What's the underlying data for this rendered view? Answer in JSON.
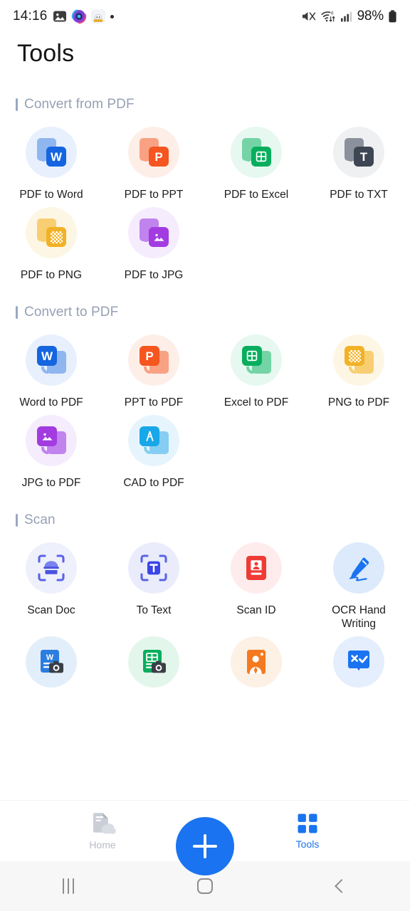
{
  "status_bar": {
    "time": "14:16",
    "battery_percent": "98%",
    "icons": [
      "gallery-icon",
      "circle-app-icon",
      "cat-app-icon",
      "dot-indicator",
      "mute-icon",
      "wifi-6-icon",
      "signal-bars-icon",
      "battery-icon"
    ]
  },
  "header": {
    "title": "Tools"
  },
  "sections": [
    {
      "title": "Convert from PDF",
      "items": [
        {
          "label": "PDF to Word",
          "icon": "pdf-to-word-icon",
          "glyph": "W",
          "badge_color": "#1565e0",
          "sheet_color": "#8fb6ef",
          "bg": "#e8f0fd",
          "layout": "from"
        },
        {
          "label": "PDF to PPT",
          "icon": "pdf-to-ppt-icon",
          "glyph": "P",
          "badge_color": "#f5551f",
          "sheet_color": "#f9a183",
          "bg": "#fdeee8",
          "layout": "from"
        },
        {
          "label": "PDF to Excel",
          "icon": "pdf-to-excel-icon",
          "glyph": "grid",
          "badge_color": "#08ae5e",
          "sheet_color": "#74d4a6",
          "bg": "#e6f8ef",
          "layout": "from"
        },
        {
          "label": "PDF to TXT",
          "icon": "pdf-to-txt-icon",
          "glyph": "T",
          "badge_color": "#3e4654",
          "sheet_color": "#8b919c",
          "bg": "#eef0f2",
          "layout": "from"
        },
        {
          "label": "PDF to PNG",
          "icon": "pdf-to-png-icon",
          "glyph": "checker",
          "badge_color": "#f2b227",
          "sheet_color": "#f7cf72",
          "bg": "#fdf6e4",
          "layout": "from"
        },
        {
          "label": "PDF to JPG",
          "icon": "pdf-to-jpg-icon",
          "glyph": "photo",
          "badge_color": "#a23ce0",
          "sheet_color": "#c183ee",
          "bg": "#f5ecfd",
          "layout": "from"
        }
      ]
    },
    {
      "title": "Convert to PDF",
      "items": [
        {
          "label": "Word to PDF",
          "icon": "word-to-pdf-icon",
          "glyph": "W",
          "badge_color": "#1565e0",
          "sheet_color": "#8fb6ef",
          "bg": "#e8f0fd",
          "layout": "to"
        },
        {
          "label": "PPT to PDF",
          "icon": "ppt-to-pdf-icon",
          "glyph": "P",
          "badge_color": "#f5551f",
          "sheet_color": "#f9a183",
          "bg": "#fdeee8",
          "layout": "to"
        },
        {
          "label": "Excel to PDF",
          "icon": "excel-to-pdf-icon",
          "glyph": "grid",
          "badge_color": "#08ae5e",
          "sheet_color": "#74d4a6",
          "bg": "#e6f8ef",
          "layout": "to"
        },
        {
          "label": "PNG to PDF",
          "icon": "png-to-pdf-icon",
          "glyph": "checker",
          "badge_color": "#f2b227",
          "sheet_color": "#f7cf72",
          "bg": "#fdf6e4",
          "layout": "to"
        },
        {
          "label": "JPG to PDF",
          "icon": "jpg-to-pdf-icon",
          "glyph": "photo",
          "badge_color": "#a23ce0",
          "sheet_color": "#c183ee",
          "bg": "#f5ecfd",
          "layout": "to"
        },
        {
          "label": "CAD to PDF",
          "icon": "cad-to-pdf-icon",
          "glyph": "compass",
          "badge_color": "#18a7e8",
          "sheet_color": "#85cdf2",
          "bg": "#e6f5fd",
          "layout": "to"
        }
      ]
    },
    {
      "title": "Scan",
      "items": [
        {
          "label": "Scan Doc",
          "icon": "scan-doc-icon",
          "glyph": "scan-frame",
          "badge_color": "#5a63e8",
          "bg": "#eef0fb"
        },
        {
          "label": "To Text",
          "icon": "to-text-icon",
          "glyph": "scan-text",
          "badge_color": "#3b45e8",
          "bg": "#eaecfb"
        },
        {
          "label": "Scan ID",
          "icon": "scan-id-icon",
          "glyph": "id-card",
          "badge_color": "#ef3b36",
          "bg": "#fdeceb"
        },
        {
          "label": "OCR Hand Writing",
          "icon": "ocr-handwriting-icon",
          "glyph": "pen-write",
          "badge_color": "#1a73f0",
          "bg": "#dceafc"
        },
        {
          "label": "",
          "icon": "word-scan-icon",
          "glyph": "word-camera",
          "badge_color": "#2b7de0",
          "bg": "#e3eefb"
        },
        {
          "label": "",
          "icon": "excel-scan-icon",
          "glyph": "excel-camera",
          "badge_color": "#08ae5e",
          "bg": "#e3f6ec"
        },
        {
          "label": "",
          "icon": "portrait-scan-icon",
          "glyph": "portrait",
          "badge_color": "#f57a1f",
          "bg": "#fdf0e4"
        },
        {
          "label": "",
          "icon": "grading-icon",
          "glyph": "x-check",
          "badge_color": "#1a73f0",
          "bg": "#e4eefc"
        }
      ]
    }
  ],
  "tabs": [
    {
      "label": "Home",
      "icon": "home-doc-cloud-icon",
      "active": false
    },
    {
      "label": "Tools",
      "icon": "tools-grid-icon",
      "active": true
    }
  ],
  "fab": {
    "icon": "plus-icon",
    "color": "#1a73f0"
  },
  "nav_bar": {
    "recents": "recents-icon",
    "home": "home-icon",
    "back": "back-icon"
  }
}
